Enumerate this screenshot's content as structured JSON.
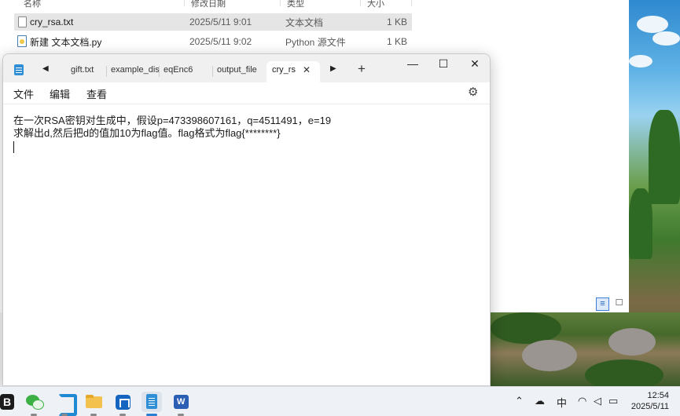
{
  "explorer": {
    "columns": [
      "名称",
      "修改日期",
      "类型",
      "大小"
    ],
    "files": [
      {
        "name": "cry_rsa.txt",
        "date": "2025/5/11 9:01",
        "type": "文本文档",
        "size": "1 KB",
        "icon": "text-file-icon",
        "selected": true
      },
      {
        "name": "新建 文本文档.py",
        "date": "2025/5/11 9:02",
        "type": "Python 源文件",
        "size": "1 KB",
        "icon": "python-file-icon",
        "selected": false
      }
    ]
  },
  "notepad": {
    "tabs": [
      {
        "label": "gift.txt"
      },
      {
        "label": "example_dis"
      },
      {
        "label": "eqEnc6"
      },
      {
        "label": "output_file"
      },
      {
        "label": "cry_rs",
        "active": true
      }
    ],
    "window_controls": {
      "minimize": "—",
      "maximize": "☐",
      "close": "✕"
    },
    "menu": {
      "file": "文件",
      "edit": "编辑",
      "view": "查看"
    },
    "content": [
      "在一次RSA密钥对生成中，假设p=473398607161，q=4511491，e=19",
      "求解出d,然后把d的值加10为flag值。flag格式为flag{********}"
    ]
  },
  "taskbar": {
    "apps": [
      "blender",
      "wechat",
      "vscode",
      "file-explorer",
      "microsoft-store",
      "notepad",
      "word"
    ],
    "blender_label": "B",
    "word_letter": "W",
    "tray": {
      "ime": "中"
    },
    "clock": {
      "time": "12:54",
      "date": "2025/5/11"
    }
  },
  "colors": {
    "accent": "#2a7fd4",
    "selection": "#e5e5e5"
  }
}
